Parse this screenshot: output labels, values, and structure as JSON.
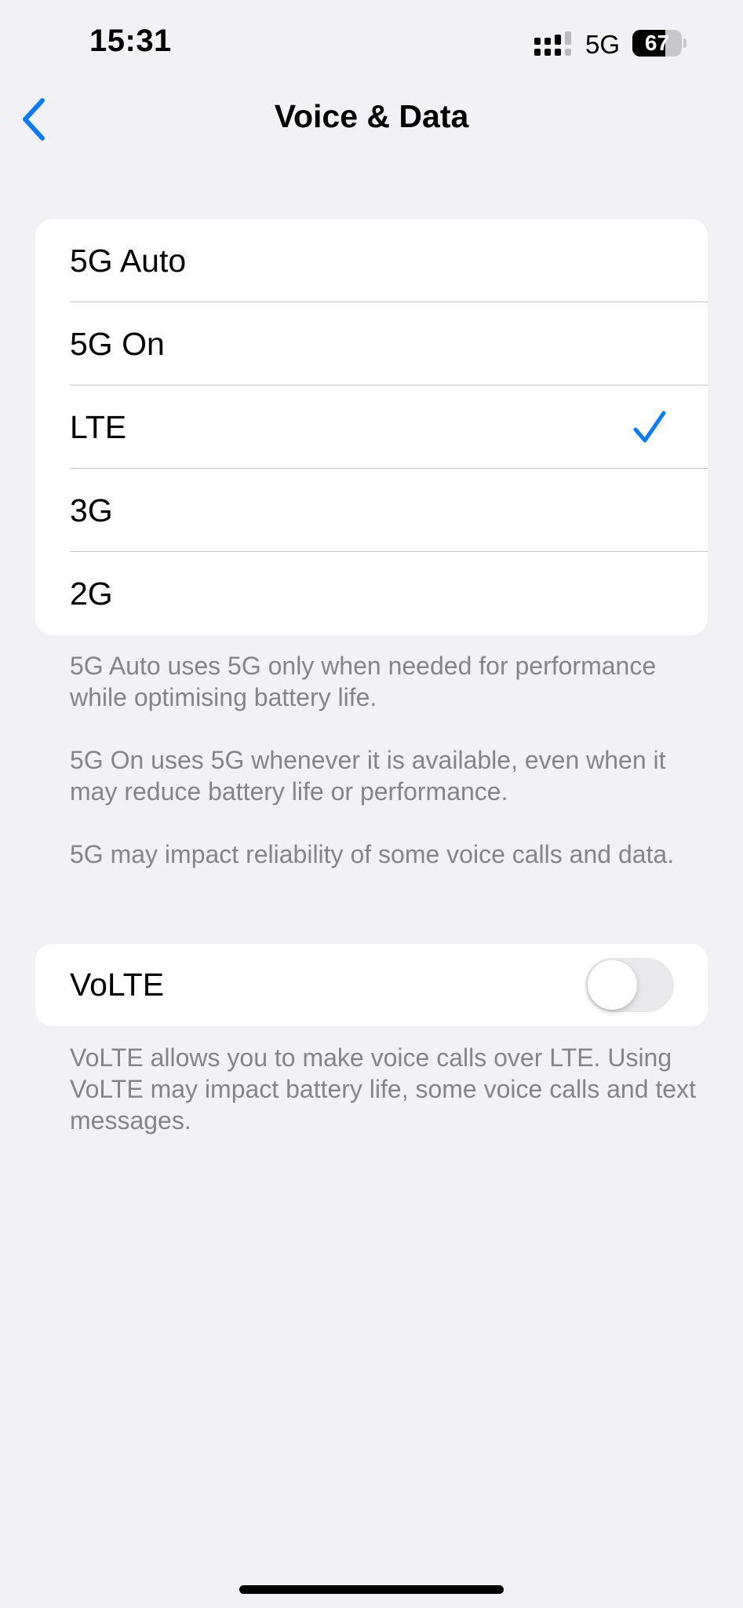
{
  "status_bar": {
    "time": "15:31",
    "network": "5G",
    "battery_percent": "67",
    "battery_level": 0.67,
    "signal_icon": "cellular-signal-icon"
  },
  "nav": {
    "title": "Voice & Data",
    "back_icon": "chevron-left-icon"
  },
  "network_options": {
    "items": [
      {
        "label": "5G Auto",
        "selected": false
      },
      {
        "label": "5G On",
        "selected": false
      },
      {
        "label": "LTE",
        "selected": true
      },
      {
        "label": "3G",
        "selected": false
      },
      {
        "label": "2G",
        "selected": false
      }
    ],
    "footnotes": [
      "5G Auto uses 5G only when needed for performance while optimising battery life.",
      "5G On uses 5G whenever it is available, even when it may reduce battery life or performance.",
      "5G may impact reliability of some voice calls and data."
    ]
  },
  "volte": {
    "label": "VoLTE",
    "enabled": false,
    "footnote": "VoLTE allows you to make voice calls over LTE. Using VoLTE may impact battery life, some voice calls and text messages."
  },
  "colors": {
    "accent": "#0a7aff",
    "background": "#f2f1f6",
    "secondary_text": "#848489",
    "toggle_off": "#e9e9eb"
  }
}
